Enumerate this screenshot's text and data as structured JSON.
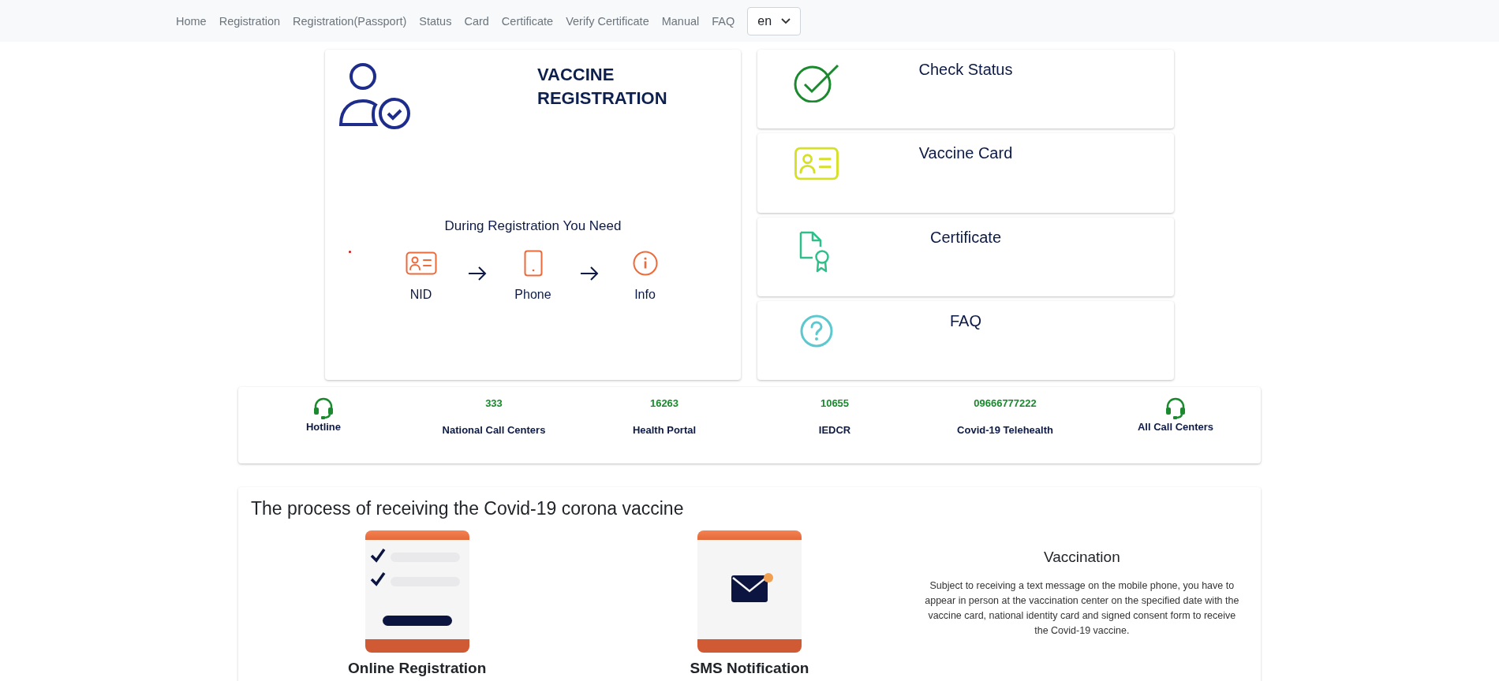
{
  "nav": {
    "items": [
      {
        "label": "Home"
      },
      {
        "label": "Registration"
      },
      {
        "label": "Registration(Passport)"
      },
      {
        "label": "Status"
      },
      {
        "label": "Card"
      },
      {
        "label": "Certificate"
      },
      {
        "label": "Verify Certificate"
      },
      {
        "label": "Manual"
      },
      {
        "label": "FAQ"
      }
    ],
    "language": "en"
  },
  "registration_card": {
    "title": "VACCINE REGISTRATION",
    "subtitle": "During Registration You Need",
    "steps": [
      {
        "kind": "id-card",
        "label": "NID"
      },
      {
        "kind": "phone",
        "label": "Phone"
      },
      {
        "kind": "info",
        "label": "Info"
      }
    ]
  },
  "quick_links": [
    {
      "kind": "check",
      "label": "Check Status"
    },
    {
      "kind": "card",
      "label": "Vaccine Card"
    },
    {
      "kind": "certificate",
      "label": "Certificate"
    },
    {
      "kind": "faq",
      "label": "FAQ"
    }
  ],
  "hotlines": [
    {
      "kind": "icon",
      "label": "Hotline"
    },
    {
      "kind": "number",
      "number": "333",
      "label": "National Call Centers"
    },
    {
      "kind": "number",
      "number": "16263",
      "label": "Health Portal"
    },
    {
      "kind": "number",
      "number": "10655",
      "label": "IEDCR"
    },
    {
      "kind": "number",
      "number": "09666777222",
      "label": "Covid-19 Telehealth"
    },
    {
      "kind": "icon",
      "label": "All Call Centers"
    }
  ],
  "process": {
    "title": "The process of receiving the Covid-19 corona vaccine",
    "steps": [
      {
        "kind": "registration",
        "label": "Online Registration"
      },
      {
        "kind": "sms",
        "label": "SMS Notification"
      },
      {
        "kind": "text",
        "title": "Vaccination",
        "description": "Subject to receiving a text message on the mobile phone, you have to appear in person at the vaccination center on the specified date with the vaccine card, national identity card and signed consent form to receive the Covid-19 vaccine."
      }
    ]
  }
}
